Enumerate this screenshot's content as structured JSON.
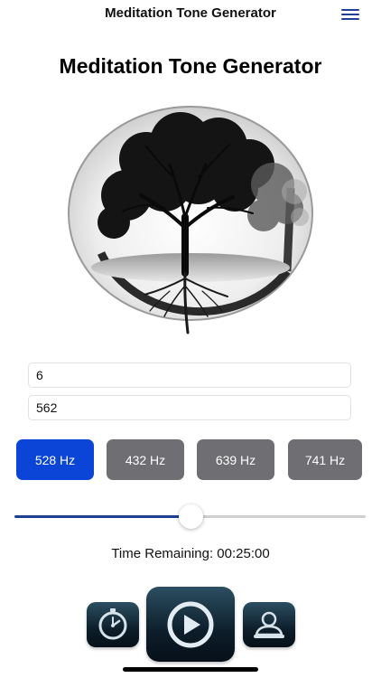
{
  "nav": {
    "title": "Meditation Tone Generator"
  },
  "page": {
    "title": "Meditation Tone Generator"
  },
  "inputs": {
    "duration_value": "6",
    "frequency_value": "562"
  },
  "frequencies": [
    {
      "label": "528 Hz",
      "selected": true
    },
    {
      "label": "432 Hz",
      "selected": false
    },
    {
      "label": "639 Hz",
      "selected": false
    },
    {
      "label": "741 Hz",
      "selected": false
    }
  ],
  "slider": {
    "value_fraction": 0.5
  },
  "timer": {
    "text": "Time Remaining: 00:25:00"
  },
  "controls": [
    {
      "name": "timer-button",
      "icon": "stopwatch-icon"
    },
    {
      "name": "play-button",
      "icon": "play-icon"
    },
    {
      "name": "profile-button",
      "icon": "person-icon"
    }
  ],
  "colors": {
    "accent": "#0a45d8",
    "unselected": "#6e6e73",
    "slider_fill": "#1e3f94",
    "control_dark": "#0d1e2a"
  }
}
